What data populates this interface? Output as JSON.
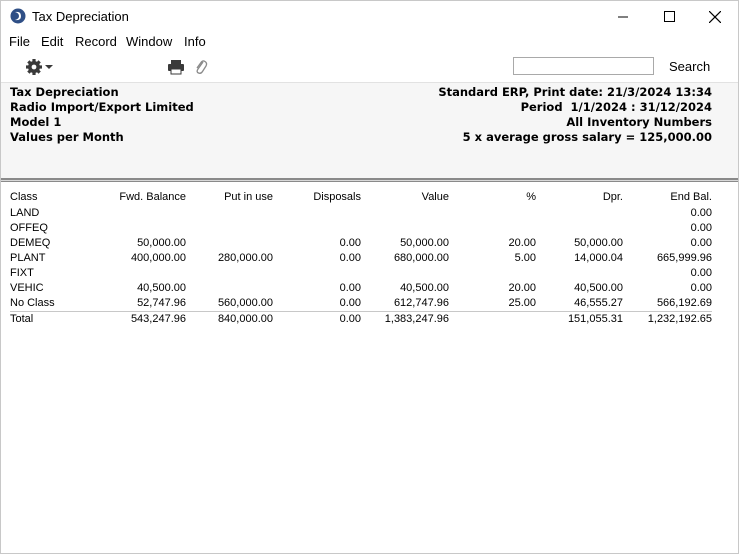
{
  "window": {
    "title": "Tax Depreciation"
  },
  "menu": [
    "File",
    "Edit",
    "Record",
    "Window",
    "Info"
  ],
  "toolbar": {
    "search_value": "",
    "search_label": "Search"
  },
  "report": {
    "left": [
      "Tax Depreciation",
      "Radio Import/Export Limited",
      "Model 1",
      "Values per Month"
    ],
    "right": [
      "Standard ERP, Print date: 21/3/2024 13:34",
      "Period  1/1/2024 : 31/12/2024",
      "All Inventory Numbers",
      "5 x average gross salary = 125,000.00"
    ]
  },
  "table": {
    "columns": [
      "Class",
      "Fwd. Balance",
      "Put in use",
      "Disposals",
      "Value",
      "%",
      "Dpr.",
      "End Bal."
    ],
    "rows": [
      [
        "LAND",
        "",
        "",
        "",
        "",
        "",
        "",
        "0.00"
      ],
      [
        "OFFEQ",
        "",
        "",
        "",
        "",
        "",
        "",
        "0.00"
      ],
      [
        "DEMEQ",
        "50,000.00",
        "",
        "0.00",
        "50,000.00",
        "20.00",
        "50,000.00",
        "0.00"
      ],
      [
        "PLANT",
        "400,000.00",
        "280,000.00",
        "0.00",
        "680,000.00",
        "5.00",
        "14,000.04",
        "665,999.96"
      ],
      [
        "FIXT",
        "",
        "",
        "",
        "",
        "",
        "",
        "0.00"
      ],
      [
        "VEHIC",
        "40,500.00",
        "",
        "0.00",
        "40,500.00",
        "20.00",
        "40,500.00",
        "0.00"
      ],
      [
        "No Class",
        "52,747.96",
        "560,000.00",
        "0.00",
        "612,747.96",
        "25.00",
        "46,555.27",
        "566,192.69"
      ]
    ],
    "total": [
      "Total",
      "543,247.96",
      "840,000.00",
      "0.00",
      "1,383,247.96",
      "",
      "151,055.31",
      "1,232,192.65"
    ]
  }
}
